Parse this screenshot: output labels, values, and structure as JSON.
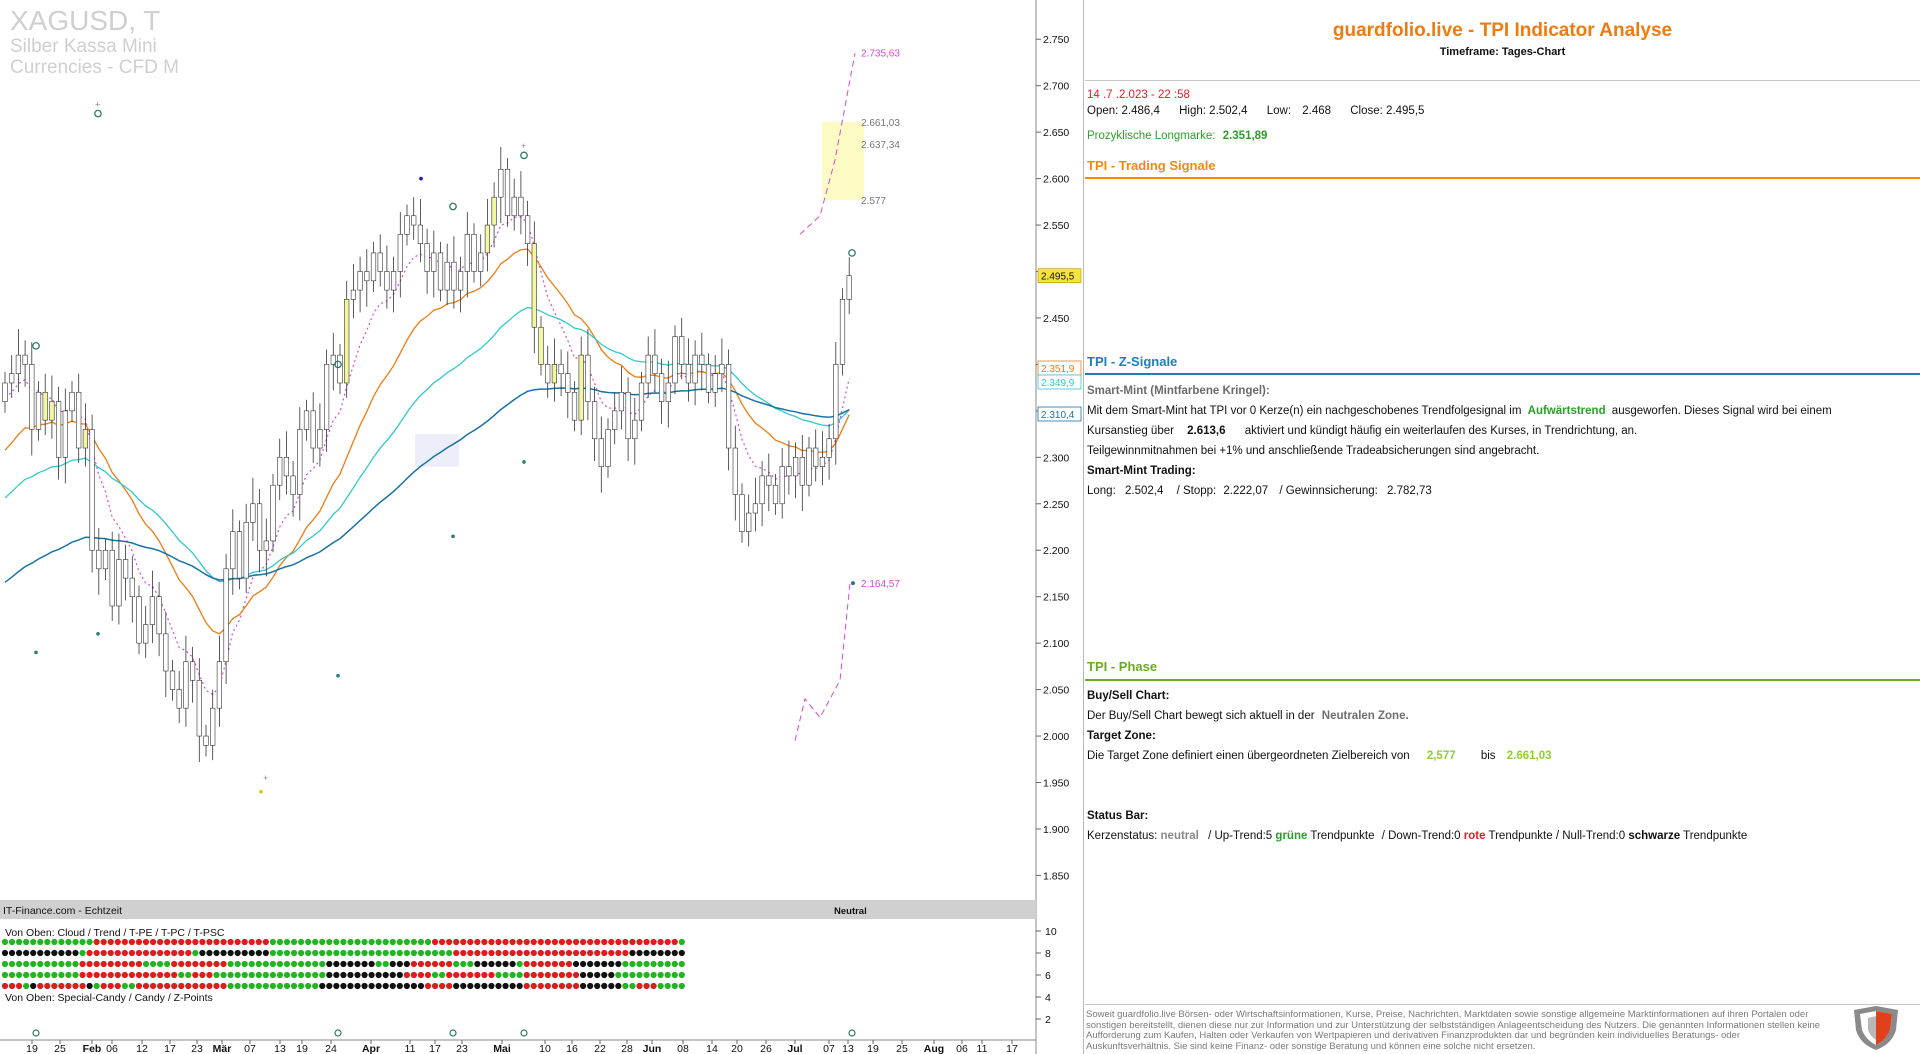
{
  "colors": {
    "orange": "#ef7b10",
    "tpi_signal_orange": "#f28a12",
    "tpi_z_blue": "#1d7fb6",
    "tpi_phase_green": "#6aa928",
    "red": "#e41e26",
    "green_dot": "#22b422",
    "red_dot": "#dd1d1d",
    "black_dot": "#111111",
    "candle_body": "#ffffff",
    "candle_highlight": "#f2f7a0",
    "sma_teal": "#2ec9cf",
    "sma_blue": "#1773a6",
    "ema_orange": "#ef7b10",
    "dotted_magenta": "#d44ad8",
    "target_zone": "#fdfbc4"
  },
  "chart_header": {
    "symbol": "XAGUSD, T",
    "name": "Silber Kassa Mini",
    "market": "Currencies - CFD M"
  },
  "source_label": "IT-Finance.com - Echtzeit",
  "status_label": "Neutral",
  "indicator_top_label": "Von Oben: Cloud / Trend / T-PE / T-PC / T-PSC",
  "indicator_bottom_label": "Von Oben: Special-Candy / Candy / Z-Points",
  "chart_data": {
    "type": "candlestick",
    "ylim": [
      1.83,
      2.775
    ],
    "y_ticks": [
      "2.750",
      "2.700",
      "2.650",
      "2.600",
      "2.550",
      "2.500",
      "2.450",
      "2.400",
      "2.350",
      "2.300",
      "2.250",
      "2.200",
      "2.150",
      "2.100",
      "2.050",
      "2.000",
      "1.950",
      "1.900",
      "1.850"
    ],
    "x_ticks": [
      "19",
      "25",
      "Feb",
      "06",
      "12",
      "17",
      "23",
      "Mär",
      "07",
      "13",
      "19",
      "24",
      "Apr",
      "11",
      "17",
      "23",
      "Mai",
      "10",
      "16",
      "22",
      "28",
      "Jun",
      "08",
      "14",
      "20",
      "26",
      "Jul",
      "07",
      "13",
      "19",
      "25",
      "Aug",
      "06",
      "11",
      "17"
    ],
    "current_price_label": "2.495,5",
    "current_price": 2.4955,
    "ma_labels": [
      {
        "value": 2.3519,
        "text": "2.351,9",
        "color": "#ef7b10"
      },
      {
        "value": 2.3499,
        "text": "2.349,9",
        "color": "#2ec9cf"
      },
      {
        "value": 2.3104,
        "text": "2.310,4",
        "color": "#1773a6"
      }
    ],
    "projection_labels": [
      {
        "value": 2.7356,
        "text": "2.735,63",
        "color": "#d44ad8"
      },
      {
        "value": 2.661,
        "text": "2.661,03",
        "color": "#777777"
      },
      {
        "value": 2.6373,
        "text": "2.637,34",
        "color": "#777777"
      },
      {
        "value": 2.577,
        "text": "2.577",
        "color": "#777777"
      },
      {
        "value": 2.1646,
        "text": "2.164,57",
        "color": "#d44ad8"
      }
    ],
    "target_zone": [
      2.577,
      2.661
    ],
    "closes": [
      2.38,
      2.39,
      2.41,
      2.4,
      2.33,
      2.37,
      2.34,
      2.36,
      2.3,
      2.35,
      2.37,
      2.31,
      2.33,
      2.2,
      2.18,
      2.2,
      2.14,
      2.19,
      2.17,
      2.15,
      2.1,
      2.12,
      2.15,
      2.11,
      2.07,
      2.05,
      2.03,
      2.08,
      2.06,
      2.0,
      1.99,
      2.03,
      2.08,
      2.18,
      2.22,
      2.17,
      2.23,
      2.25,
      2.2,
      2.21,
      2.27,
      2.3,
      2.28,
      2.26,
      2.33,
      2.35,
      2.31,
      2.33,
      2.4,
      2.41,
      2.38,
      2.47,
      2.48,
      2.5,
      2.49,
      2.52,
      2.5,
      2.48,
      2.5,
      2.54,
      2.56,
      2.55,
      2.53,
      2.5,
      2.52,
      2.48,
      2.51,
      2.48,
      2.5,
      2.54,
      2.5,
      2.52,
      2.55,
      2.58,
      2.61,
      2.56,
      2.58,
      2.56,
      2.53,
      2.44,
      2.4,
      2.38,
      2.4,
      2.39,
      2.37,
      2.34,
      2.41,
      2.36,
      2.32,
      2.29,
      2.33,
      2.35,
      2.37,
      2.32,
      2.34,
      2.38,
      2.41,
      2.39,
      2.36,
      2.38,
      2.43,
      2.4,
      2.38,
      2.41,
      2.4,
      2.37,
      2.39,
      2.4,
      2.31,
      2.26,
      2.22,
      2.24,
      2.25,
      2.28,
      2.27,
      2.25,
      2.29,
      2.28,
      2.3,
      2.27,
      2.31,
      2.29,
      2.3,
      2.32,
      2.4,
      2.47,
      2.4955
    ]
  },
  "panel": {
    "title": "guardfolio.live - TPI Indicator Analyse",
    "timeframe": "Timeframe: Tages-Chart",
    "datetime": "14 .7 .2.023 - 22 :58",
    "ohlc": {
      "open_label": "Open:",
      "open": "2.486,4",
      "high_label": "High:",
      "high": "2.502,4",
      "low_label": "Low:",
      "low": "2.468",
      "close_label": "Close:",
      "close": "2.495,5"
    },
    "longmarke_label": "Prozyklische Longmarke:",
    "longmarke_value": "2.351,89",
    "trading_signale": "TPI - Trading Signale",
    "z_signale": "TPI - Z-Signale",
    "smart_mint_heading": "Smart-Mint (Mintfarbene Kringel):",
    "sm_p1": "Mit dem Smart-Mint hat TPI vor 0  Kerze(n) ein nachgeschobenes Trendfolgesignal im",
    "sm_p1_trend": "Aufwärtstrend",
    "sm_p1_end": "ausgeworfen. Dieses Signal wird bei einem",
    "sm_p2_start": "Kursanstieg über",
    "sm_p2_value": "2.613,6",
    "sm_p2_end": "aktiviert und kündigt häufig ein weiterlaufen des Kurses, in Trendrichtung, an.",
    "sm_p3": "Teilgewinnmitnahmen bei +1% und anschließende Tradeabsicherungen sind angebracht.",
    "sm_trading_heading": "Smart-Mint Trading:",
    "long_label": "Long:",
    "long_value": "2.502,4",
    "stopp_label": "/ Stopp:",
    "stopp_value": "2.222,07",
    "gewinn_label": "/ Gewinnsicherung:",
    "gewinn_value": "2.782,73",
    "phase": "TPI - Phase",
    "buysell_heading": "Buy/Sell Chart:",
    "buysell_text": "Der Buy/Sell Chart bewegt sich aktuell in der",
    "buysell_zone": "Neutralen Zone.",
    "target_heading": "Target Zone:",
    "target_text": "Die Target Zone definiert einen übergeordneten Zielbereich von",
    "target_from": "2,577",
    "target_bis": "bis",
    "target_to": "2.661,03",
    "status_heading": "Status Bar:",
    "kerzen_label": "Kerzenstatus:",
    "kerzen_value": "neutral",
    "up_label": "/ Up-Trend:5",
    "up_word": "grüne",
    "tp1": "Trendpunkte",
    "down_label": "/ Down-Trend:0",
    "down_word": "rote",
    "tp2": "Trendpunkte",
    "null_label": "/ Null-Trend:0",
    "null_word": "schwarze",
    "tp3": "Trendpunkte",
    "disclaimer": "Soweit guardfolio.live Börsen- oder Wirtschaftsinformationen, Kurse, Preise, Nachrichten, Marktdaten sowie sonstige allgemeine Marktinformationen auf ihren Portalen oder sonstigen bereitstellt, dienen diese nur zur Information und zur Unterstützung der selbstständigen Anlageentscheidung des Nutzers. Die genannten Informationen stellen keine Aufforderung zum Kaufen, Halten oder Verkaufen von Wertpapieren und derivativen Finanzprodukten dar und begründen kein individuelles Beratungs- oder Auskunftsverhältnis. Sie sind keine Finanz- oder sonstige Beratung und können eine solche nicht ersetzen."
  }
}
